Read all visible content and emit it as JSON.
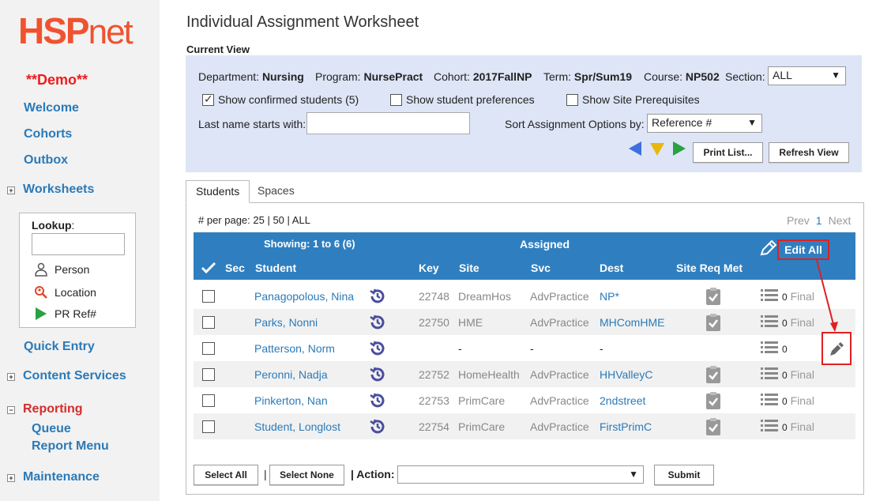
{
  "sidebar": {
    "logo_main": "HSP",
    "logo_suffix": "net",
    "demo_label": "**Demo**",
    "nav": {
      "welcome": "Welcome",
      "cohorts": "Cohorts",
      "outbox": "Outbox",
      "worksheets": "Worksheets",
      "quick_entry": "Quick Entry",
      "content_services": "Content Services",
      "reporting": "Reporting",
      "queue": "Queue",
      "report_menu": "Report Menu",
      "maintenance": "Maintenance"
    },
    "lookup": {
      "label": "Lookup",
      "input_value": "",
      "options": {
        "person": "Person",
        "location": "Location",
        "pr_ref": "PR Ref#"
      }
    }
  },
  "page": {
    "title": "Individual Assignment Worksheet",
    "current_view_label": "Current View"
  },
  "view": {
    "department_label": "Department:",
    "department": "Nursing",
    "program_label": "Program:",
    "program": "NursePract",
    "cohort_label": "Cohort:",
    "cohort": "2017FallNP",
    "term_label": "Term:",
    "term": "Spr/Sum19",
    "course_label": "Course:",
    "course": "NP502",
    "section_label": "Section:",
    "section_value": "ALL",
    "show_confirmed": "Show confirmed students (5)",
    "show_preferences": "Show student preferences",
    "show_prereqs": "Show Site Prerequisites",
    "last_name_label": "Last name starts with:",
    "last_name_value": "",
    "sort_label": "Sort Assignment Options by:",
    "sort_value": "Reference #",
    "print_list": "Print List...",
    "refresh_view": "Refresh View",
    "colors": {
      "prev": "#3d6fe0",
      "mid": "#e8b70c",
      "next": "#2aa142"
    }
  },
  "tabs": {
    "students": "Students",
    "spaces": "Spaces"
  },
  "paging": {
    "per_page": "# per page: 25 | 50 | ALL",
    "prev": "Prev",
    "current": "1",
    "next": "Next"
  },
  "table": {
    "showing": "Showing: 1 to 6 (6)",
    "assigned": "Assigned",
    "edit_all": "Edit All",
    "columns": {
      "sec": "Sec",
      "student": "Student",
      "key": "Key",
      "site": "Site",
      "svc": "Svc",
      "dest": "Dest",
      "site_req_met": "Site Req Met"
    },
    "rows": [
      {
        "student": "Panagopolous, Nina",
        "key": "22748",
        "site": "DreamHos",
        "svc": "AdvPractice",
        "dest": "NP*",
        "count": "0",
        "final": "Final"
      },
      {
        "student": "Parks, Nonni",
        "key": "22750",
        "site": "HME",
        "svc": "AdvPractice",
        "dest": "MHComHME",
        "count": "0",
        "final": "Final"
      },
      {
        "student": "Patterson, Norm",
        "key": "",
        "site": "-",
        "svc": "-",
        "dest": "-",
        "count": "0",
        "final": ""
      },
      {
        "student": "Peronni, Nadja",
        "key": "22752",
        "site": "HomeHealth",
        "svc": "AdvPractice",
        "dest": "HHValleyC",
        "count": "0",
        "final": "Final"
      },
      {
        "student": "Pinkerton, Nan",
        "key": "22753",
        "site": "PrimCare",
        "svc": "AdvPractice",
        "dest": "2ndstreet",
        "count": "0",
        "final": "Final"
      },
      {
        "student": "Student, Longlost",
        "key": "22754",
        "site": "PrimCare",
        "svc": "AdvPractice",
        "dest": "FirstPrimC",
        "count": "0",
        "final": "Final"
      }
    ]
  },
  "bottom": {
    "select_all": "Select All",
    "separator": "|",
    "select_none": "Select None",
    "action_label": "| Action:",
    "action_value": "",
    "submit": "Submit"
  }
}
